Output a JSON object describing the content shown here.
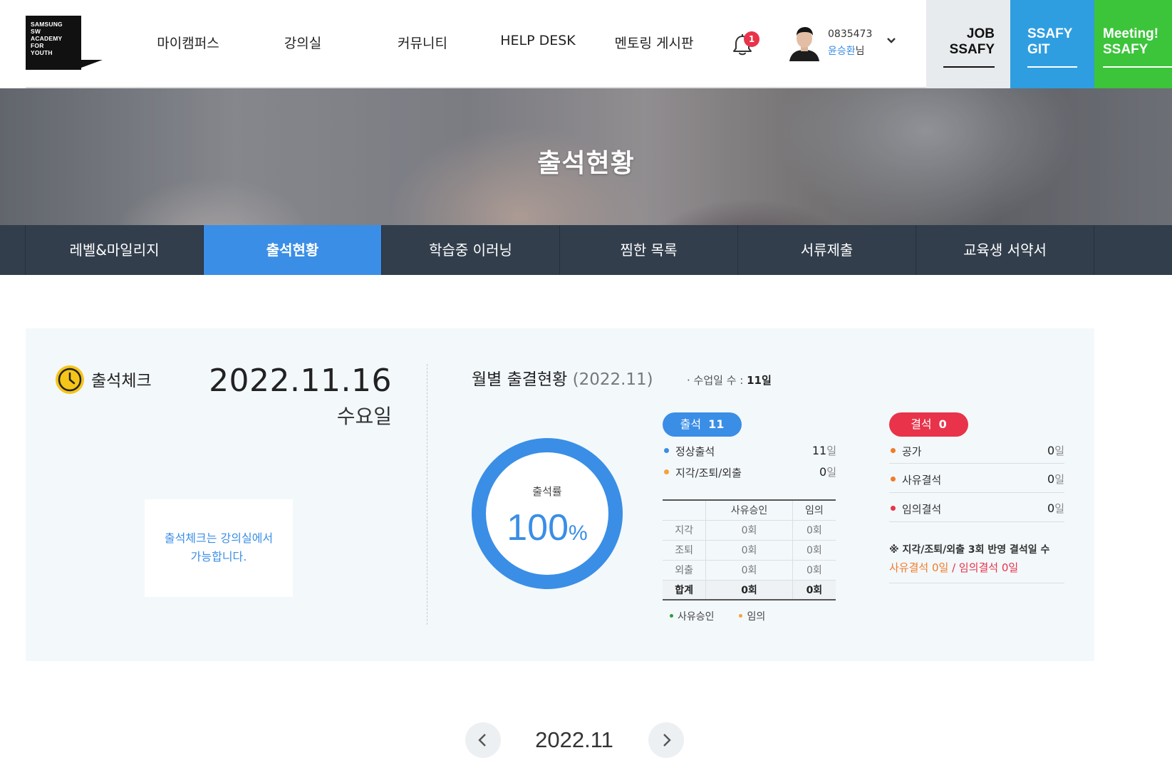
{
  "logo": {
    "lines": [
      "SAMSUNG",
      "SW",
      "ACADEMY",
      "FOR",
      "YOUTH"
    ]
  },
  "nav": {
    "items": [
      {
        "label": "마이캠퍼스"
      },
      {
        "label": "강의실"
      },
      {
        "label": "커뮤니티"
      },
      {
        "label": "HELP DESK"
      },
      {
        "label": "멘토링 게시판"
      }
    ]
  },
  "notifications": {
    "count": "1",
    "icon": "bell-icon"
  },
  "user": {
    "id": "0835473",
    "name": "윤승환",
    "suffix": "님"
  },
  "side_links": {
    "job": {
      "line1": "JOB",
      "line2": "SSAFY"
    },
    "git": {
      "line1": "SSAFY",
      "line2": "GIT"
    },
    "meeting": {
      "line1": "Meeting!",
      "line2": "SSAFY"
    }
  },
  "hero": {
    "title": "출석현황"
  },
  "tabs": [
    {
      "label": "레벨&마일리지",
      "active": false
    },
    {
      "label": "출석현황",
      "active": true
    },
    {
      "label": "학습중 이러닝",
      "active": false
    },
    {
      "label": "찜한 목록",
      "active": false
    },
    {
      "label": "서류제출",
      "active": false
    },
    {
      "label": "교육생 서약서",
      "active": false
    }
  ],
  "attendance_check": {
    "title": "출석체크",
    "date": "2022.11.16",
    "weekday": "수요일",
    "notice_line1": "출석체크는 강의실에서",
    "notice_line2": "가능합니다."
  },
  "monthly": {
    "title": "월별 출결현황",
    "month_paren": "(2022.11)",
    "class_days_label": "· 수업일 수 :",
    "class_days_value": "11일",
    "rate_label": "출석률",
    "rate_value": "100",
    "rate_unit": "%",
    "rate_fraction": 1.0,
    "attendance_pill": {
      "label": "출석",
      "value": "11"
    },
    "absence_pill": {
      "label": "결석",
      "value": "0"
    },
    "attendance_rows": [
      {
        "label": "정상출석",
        "value": "11",
        "unit": "일",
        "dot": "#3a8ee6"
      },
      {
        "label": "지각/조퇴/외출",
        "value": "0",
        "unit": "일",
        "dot": "#f7a23b"
      }
    ],
    "late_table": {
      "headers": [
        "",
        "사유승인",
        "임의"
      ],
      "rows": [
        {
          "label": "지각",
          "approved": "0회",
          "arbitrary": "0회"
        },
        {
          "label": "조퇴",
          "approved": "0회",
          "arbitrary": "0회"
        },
        {
          "label": "외출",
          "approved": "0회",
          "arbitrary": "0회"
        }
      ],
      "total": {
        "label": "합계",
        "approved": "0회",
        "arbitrary": "0회"
      }
    },
    "legend": [
      {
        "label": "사유승인",
        "color": "#2e9b3a"
      },
      {
        "label": "임의",
        "color": "#f7a23b"
      }
    ],
    "absence_rows": [
      {
        "label": "공가",
        "value": "0",
        "unit": "일",
        "dot": "#f07c2a"
      },
      {
        "label": "사유결석",
        "value": "0",
        "unit": "일",
        "dot": "#f07c2a"
      },
      {
        "label": "임의결석",
        "value": "0",
        "unit": "일",
        "dot": "#e8334a"
      }
    ],
    "note_line1": "※ 지각/조퇴/외출 3회 반영 결석일 수",
    "note_reason": "사유결석 0일",
    "note_sep": " / ",
    "note_arbitrary": "임의결석 0일"
  },
  "month_nav": {
    "label": "2022.11",
    "prev_icon": "chevron-left-icon",
    "next_icon": "chevron-right-icon"
  },
  "colors": {
    "accent": "#3a8ee6",
    "danger": "#e8334a",
    "tabbar": "#323e4c",
    "panel": "#f3f8fb"
  }
}
